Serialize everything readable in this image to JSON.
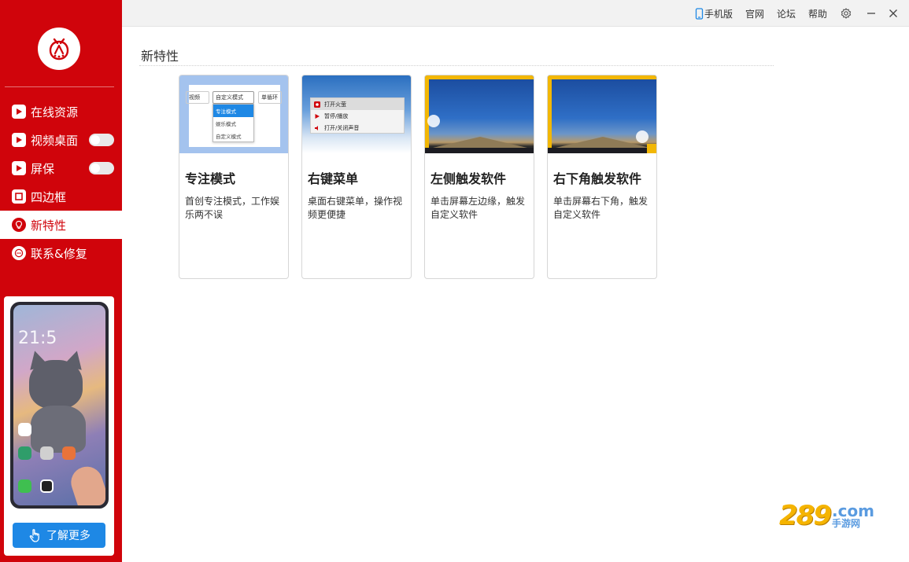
{
  "colors": {
    "brand_red": "#d0040b",
    "accent_blue": "#1e88e5",
    "highlight_yellow": "#f2b705"
  },
  "sidebar": {
    "logo_icon": "firefly-logo-icon",
    "items": [
      {
        "label": "在线资源",
        "icon": "play-square-icon",
        "has_toggle": false,
        "active": false
      },
      {
        "label": "视频桌面",
        "icon": "play-square-icon",
        "has_toggle": true,
        "toggle_on": false,
        "active": false
      },
      {
        "label": "屏保",
        "icon": "play-square-icon",
        "has_toggle": true,
        "toggle_on": false,
        "active": false
      },
      {
        "label": "四边框",
        "icon": "square-frame-icon",
        "has_toggle": false,
        "active": false
      },
      {
        "label": "新特性",
        "icon": "bulb-icon",
        "has_toggle": false,
        "active": true
      },
      {
        "label": "联系&修复",
        "icon": "chat-dots-icon",
        "has_toggle": false,
        "active": false
      }
    ],
    "promo": {
      "clock": "21:5",
      "button_label": "了解更多",
      "button_icon": "hand-pointer-icon"
    }
  },
  "topbar": {
    "links": [
      {
        "label": "手机版",
        "icon": "phone-icon"
      },
      {
        "label": "官网"
      },
      {
        "label": "论坛"
      },
      {
        "label": "帮助"
      }
    ],
    "window_buttons": [
      "gear-icon",
      "minimize-icon",
      "close-icon"
    ]
  },
  "main": {
    "title": "新特性",
    "cards": [
      {
        "title": "专注模式",
        "desc": "首创专注模式，工作娱乐两不误",
        "preview": {
          "box1": "视频",
          "box2": "自定义模式",
          "box3": "单循环",
          "options": [
            "专注模式",
            "娱乐模式",
            "自定义模式"
          ]
        }
      },
      {
        "title": "右键菜单",
        "desc": "桌面右键菜单，操作视频更便捷",
        "preview": {
          "menu": [
            "打开火萤",
            "暂停/播放",
            "打开/关闭声音"
          ]
        }
      },
      {
        "title": "左侧触发软件",
        "desc": "单击屏幕左边缘，触发自定义软件"
      },
      {
        "title": "右下角触发软件",
        "desc": "单击屏幕右下角，触发自定义软件"
      }
    ]
  },
  "watermark": {
    "num": "289",
    "com": ".com",
    "cn": "手游网"
  }
}
